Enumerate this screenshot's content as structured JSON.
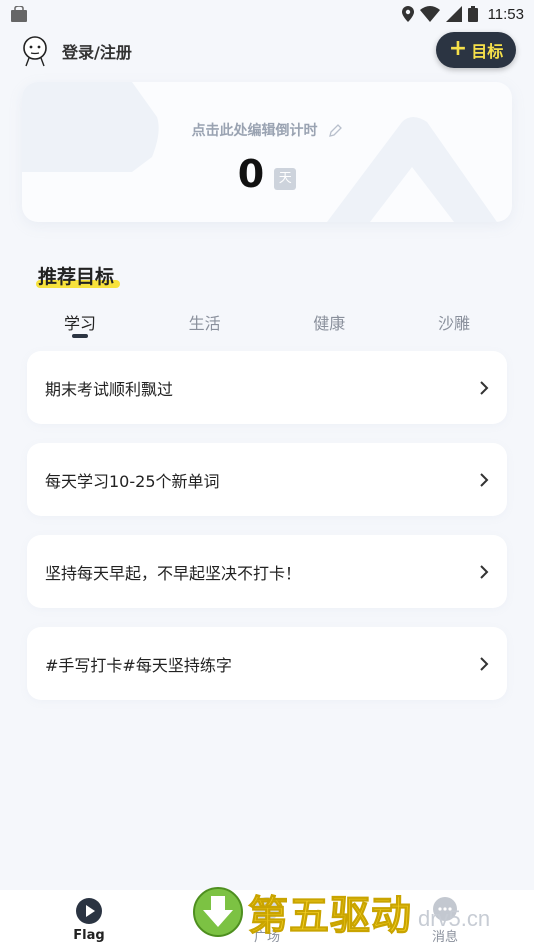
{
  "status_bar": {
    "time": "11:53"
  },
  "header": {
    "login_label": "登录/注册",
    "goal_button_label": "目标"
  },
  "countdown": {
    "label": "点击此处编辑倒计时",
    "value": "0",
    "unit": "天"
  },
  "recommend": {
    "title": "推荐目标",
    "tabs": [
      {
        "label": "学习",
        "active": true
      },
      {
        "label": "生活",
        "active": false
      },
      {
        "label": "健康",
        "active": false
      },
      {
        "label": "沙雕",
        "active": false
      }
    ],
    "items": [
      {
        "label": "期末考试顺利飘过"
      },
      {
        "label": "每天学习10-25个新单词"
      },
      {
        "label": "坚持每天早起，不早起坚决不打卡！"
      },
      {
        "label": "#手写打卡#每天坚持练字"
      }
    ]
  },
  "bottom_nav": [
    {
      "label": "Flag",
      "active": true
    },
    {
      "label": "广场",
      "active": false
    },
    {
      "label": "消息",
      "active": false
    }
  ],
  "watermark": {
    "text": "第五驱动",
    "domain": "drv5.cn"
  },
  "colors": {
    "accent_dark": "#2b3442",
    "highlight_yellow": "#f7e23c",
    "background": "#f5f7fb"
  }
}
